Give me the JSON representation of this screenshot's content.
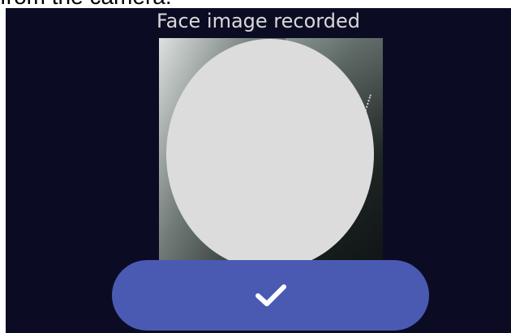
{
  "page_caption": "from the camera.",
  "screen": {
    "title": "Face image recorded",
    "confirm_button": {
      "icon": "check-icon"
    }
  },
  "colors": {
    "screen_background": "#0b0c24",
    "title_text": "#d9d9d9",
    "face_mask": "#dcdcdc",
    "button_accent": "#4a5ab3",
    "check_icon": "#ffffff"
  }
}
